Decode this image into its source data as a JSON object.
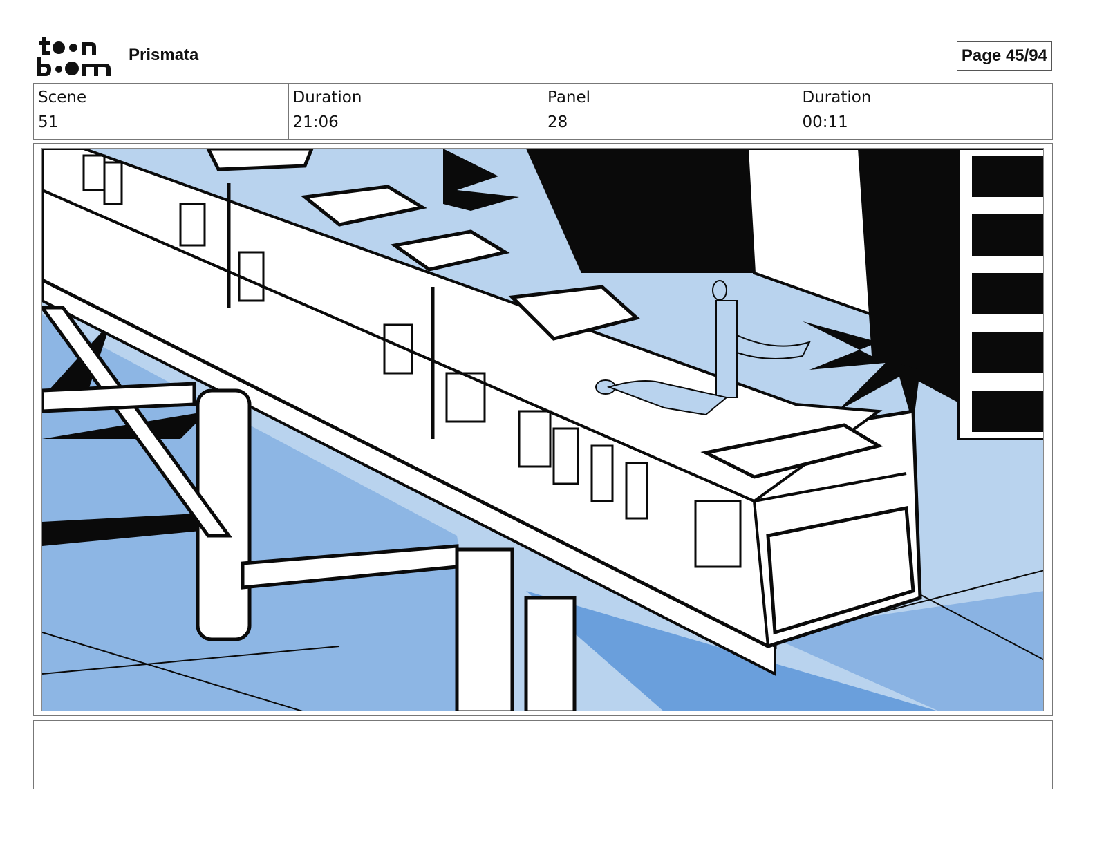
{
  "header": {
    "project_title": "Prismata",
    "page_label": "Page 45/94",
    "logo_text": "toon boom"
  },
  "info": {
    "scene_label": "Scene",
    "scene_value": "51",
    "scene_duration_label": "Duration",
    "scene_duration_value": "21:06",
    "panel_label": "Panel",
    "panel_value": "28",
    "panel_duration_label": "Duration",
    "panel_duration_value": "00:11"
  },
  "colors": {
    "light_blue": "#b9d3ee",
    "mid_blue": "#6a9fdc",
    "ink": "#0a0a0a"
  },
  "caption": {
    "text": ""
  }
}
